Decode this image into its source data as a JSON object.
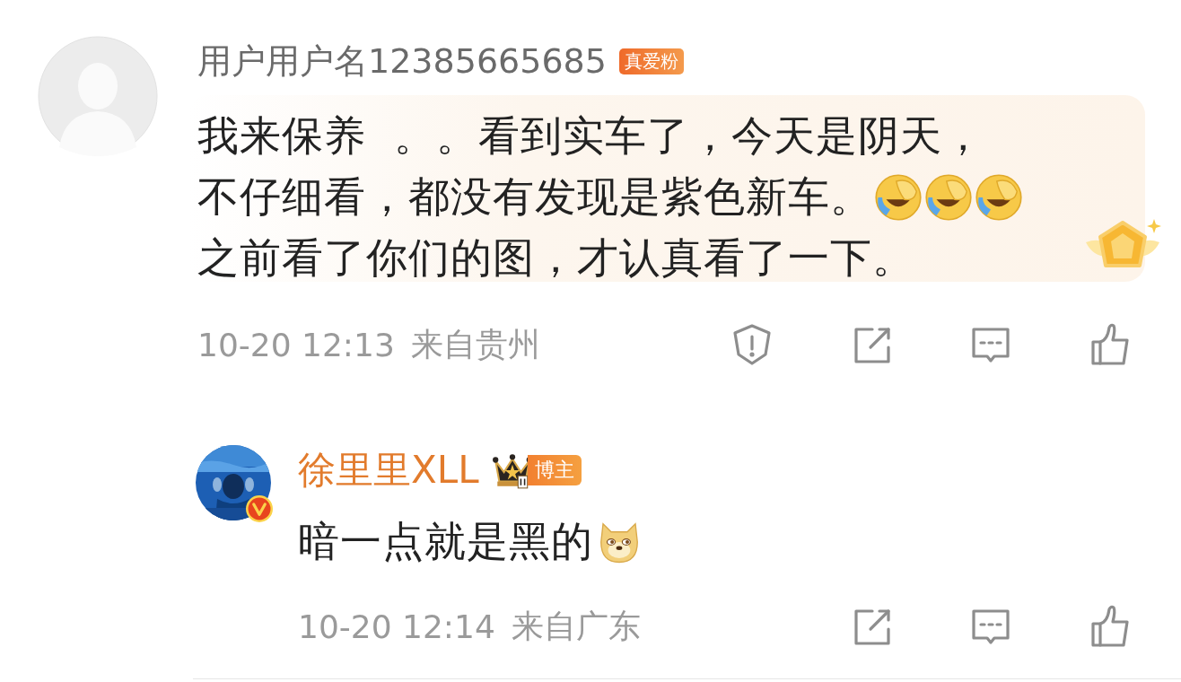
{
  "comment": {
    "username": "用户用户名12385665685",
    "badge": "真爱粉",
    "lines": [
      {
        "text": "我来保养  。。看到实车了，今天是阴天，"
      },
      {
        "text": "不仔细看，都没有发现是紫色新车。",
        "emojis": [
          {
            "kind": "facepalm-laugh"
          },
          {
            "kind": "facepalm-laugh"
          },
          {
            "kind": "facepalm-laugh"
          }
        ]
      },
      {
        "text": "之前看了你们的图，才认真看了一下。"
      }
    ],
    "time": "10-20 12:13",
    "location": "来自贵州",
    "actions": [
      {
        "kind": "report"
      },
      {
        "kind": "share"
      },
      {
        "kind": "reply"
      },
      {
        "kind": "like"
      }
    ]
  },
  "reply": {
    "username": "徐里里XLL",
    "role": "博主",
    "verified": true,
    "lines": [
      {
        "text": "暗一点就是黑的",
        "emojis": [
          {
            "kind": "doge"
          }
        ]
      }
    ],
    "time": "10-20 12:14",
    "location": "来自广东",
    "actions": [
      {
        "kind": "share"
      },
      {
        "kind": "reply"
      },
      {
        "kind": "like"
      }
    ]
  }
}
